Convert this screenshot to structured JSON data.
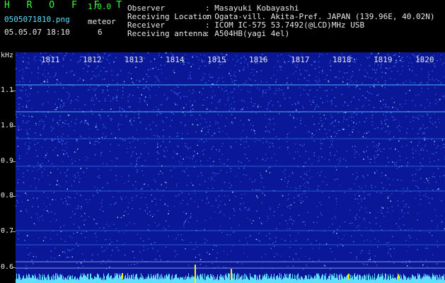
{
  "header": {
    "app_logo": "H R O F F T",
    "version": "1.0.0",
    "filename": "0505071810.png",
    "datetime": "05.05.07 18:10",
    "meteor_label": "meteor",
    "meteor_count": "6",
    "info": [
      {
        "label": "Observer",
        "value": ": Masayuki Kobayashi"
      },
      {
        "label": "Receiving Location",
        "value": ": Ogata-vill. Akita-Pref. JAPAN (139.96E, 40.02N)"
      },
      {
        "label": "Receiver",
        "value": ": ICOM IC-575 53.7492(@LCD)MHz USB"
      },
      {
        "label": "Receiving antenna",
        "value": ": A504HB(yagi 4el)"
      }
    ]
  },
  "spectrogram": {
    "y_unit": "kHz",
    "y_labels": [
      "1.1",
      "1.0",
      "0.9",
      "0.8",
      "0.7",
      "0.6"
    ],
    "time_labels": [
      "1811",
      "1812",
      "1813",
      "1814",
      "1815",
      "1816",
      "1817",
      "1818",
      "1819",
      "1820"
    ],
    "colors": {
      "background": "#0a1796",
      "noise": "#3a6cff",
      "trace": "#5fe0ff",
      "meteor": "#f5f500"
    }
  }
}
